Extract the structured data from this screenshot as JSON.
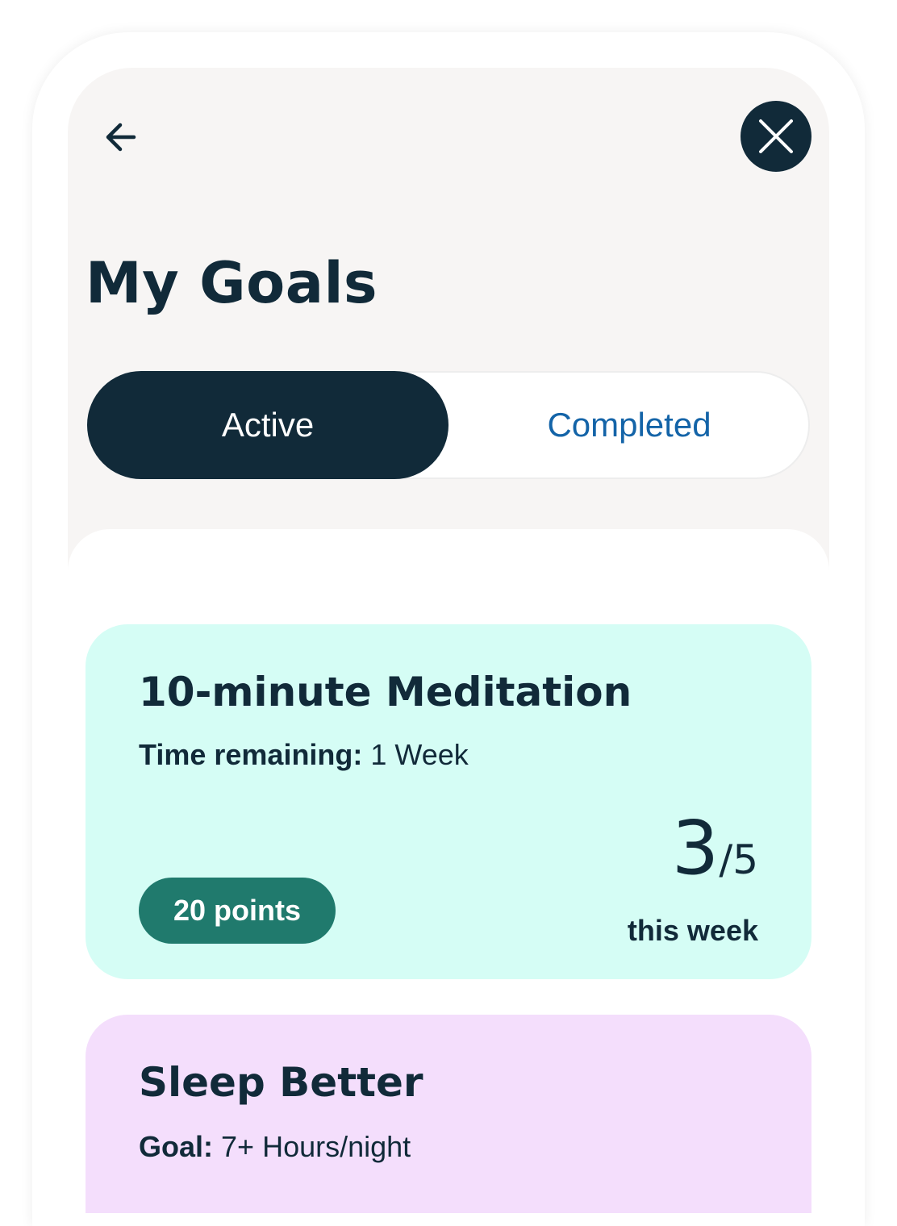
{
  "header": {
    "title": "My Goals"
  },
  "icons": {
    "back": "arrow-left-icon",
    "close": "close-x-icon"
  },
  "colors": {
    "primary_dark": "#112a39",
    "link_blue": "#1464a8",
    "meditation_card": "#d5fdf5",
    "sleep_card": "#f4defc",
    "points_badge": "#207a6d"
  },
  "tabs": [
    {
      "label": "Active",
      "selected": true
    },
    {
      "label": "Completed",
      "selected": false
    }
  ],
  "goals": [
    {
      "title": "10-minute Meditation",
      "meta_label": "Time remaining:",
      "meta_value": " 1 Week",
      "points": "20 points",
      "progress_current": "3",
      "progress_sep": "/",
      "progress_total": "5",
      "progress_label": "this week"
    },
    {
      "title": "Sleep Better",
      "meta_label": "Goal:",
      "meta_value": " 7+ Hours/night"
    }
  ]
}
